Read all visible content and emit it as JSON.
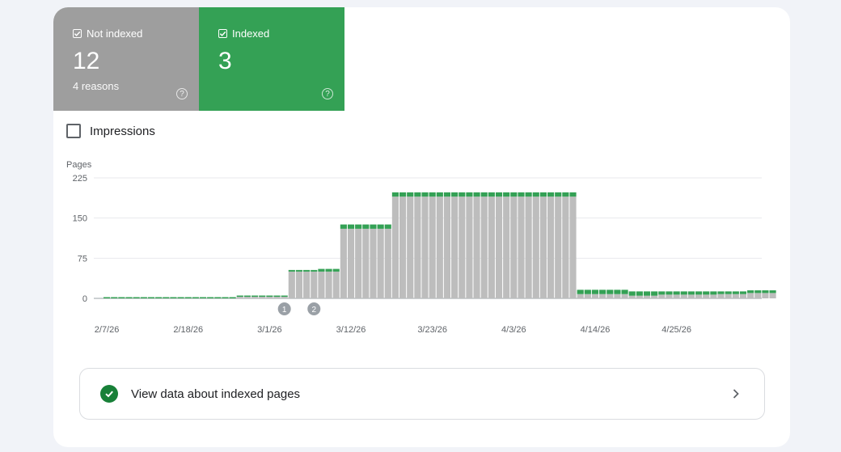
{
  "tiles": {
    "not_indexed": {
      "label": "Not indexed",
      "count": "12",
      "sub": "4 reasons",
      "help": "?"
    },
    "indexed": {
      "label": "Indexed",
      "count": "3",
      "help": "?"
    }
  },
  "impressions": {
    "label": "Impressions",
    "checked": false
  },
  "colors": {
    "not_indexed": "#bdbdbd",
    "indexed": "#34a155",
    "gridline": "#e8eaed"
  },
  "chart_data": {
    "type": "bar",
    "stacked": true,
    "ylabel": "Pages",
    "ylim": [
      0,
      225
    ],
    "yticks": [
      "225",
      "150",
      "75",
      "0"
    ],
    "xticks": [
      {
        "label": "2/7/26",
        "index": 0
      },
      {
        "label": "2/18/26",
        "index": 11
      },
      {
        "label": "3/1/26",
        "index": 22
      },
      {
        "label": "3/12/26",
        "index": 33
      },
      {
        "label": "3/23/26",
        "index": 44
      },
      {
        "label": "4/3/26",
        "index": 55
      },
      {
        "label": "4/14/26",
        "index": 66
      },
      {
        "label": "4/25/26",
        "index": 77
      }
    ],
    "annotations": [
      {
        "label": "1",
        "index": 24
      },
      {
        "label": "2",
        "index": 28
      }
    ],
    "series": [
      {
        "name": "Not indexed",
        "values": [
          0,
          0,
          0,
          0,
          0,
          0,
          0,
          0,
          0,
          0,
          0,
          0,
          0,
          0,
          0,
          0,
          0,
          0,
          3,
          3,
          3,
          3,
          3,
          3,
          3,
          50,
          50,
          50,
          50,
          50,
          50,
          50,
          130,
          130,
          130,
          130,
          130,
          130,
          130,
          190,
          190,
          190,
          190,
          190,
          190,
          190,
          190,
          190,
          190,
          190,
          190,
          190,
          190,
          190,
          190,
          190,
          190,
          190,
          190,
          190,
          190,
          190,
          190,
          190,
          8,
          8,
          8,
          8,
          8,
          8,
          8,
          5,
          5,
          5,
          5,
          7,
          7,
          7,
          7,
          7,
          7,
          7,
          7,
          8,
          8,
          8,
          8,
          10,
          10,
          10,
          10
        ]
      },
      {
        "name": "Indexed",
        "values": [
          1,
          1,
          1,
          1,
          1,
          1,
          1,
          1,
          1,
          1,
          1,
          1,
          1,
          1,
          1,
          1,
          1,
          1,
          2,
          2,
          2,
          2,
          2,
          2,
          2,
          3,
          3,
          3,
          3,
          5,
          5,
          5,
          8,
          8,
          8,
          8,
          8,
          8,
          8,
          8,
          8,
          8,
          8,
          8,
          8,
          8,
          8,
          8,
          8,
          8,
          8,
          8,
          8,
          8,
          8,
          8,
          8,
          8,
          8,
          8,
          8,
          8,
          8,
          8,
          8,
          8,
          8,
          8,
          8,
          8,
          8,
          8,
          8,
          8,
          8,
          6,
          6,
          6,
          6,
          6,
          6,
          6,
          6,
          5,
          5,
          5,
          5,
          5,
          5,
          5,
          5
        ]
      }
    ]
  },
  "link": {
    "label": "View data about indexed pages"
  }
}
